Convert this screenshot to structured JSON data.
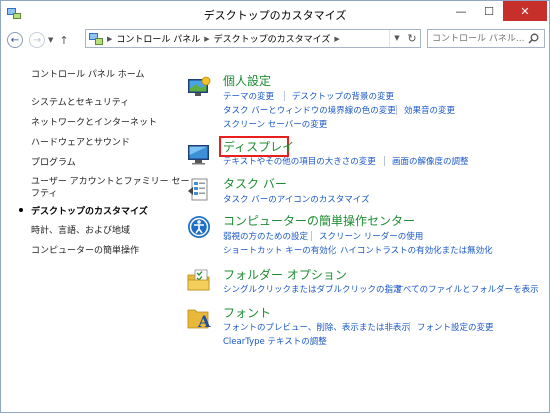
{
  "window": {
    "title": "デスクトップのカスタマイズ",
    "minimize_label": "—",
    "maximize_label": "☐",
    "close_label": "✕"
  },
  "address": {
    "breadcrumb": [
      "コントロール パネル",
      "デスクトップのカスタマイズ"
    ],
    "search_placeholder": "コントロール パネル..."
  },
  "sidebar": {
    "items": [
      {
        "label": "コントロール パネル ホーム"
      },
      {
        "label": "システムとセキュリティ"
      },
      {
        "label": "ネットワークとインターネット"
      },
      {
        "label": "ハードウェアとサウンド"
      },
      {
        "label": "プログラム"
      },
      {
        "label": "ユーザー アカウントとファミリー セー"
      },
      {
        "label": "フティ"
      },
      {
        "label": "デスクトップのカスタマイズ",
        "current": true
      },
      {
        "label": "時計、言語、および地域"
      },
      {
        "label": "コンピューターの簡単操作"
      }
    ]
  },
  "categories": [
    {
      "title": "個人設定",
      "icon": "personalization-icon",
      "links": [
        "テーマの変更",
        "デスクトップの背景の変更",
        "タスク バーとウィンドウの境界線の色の変更",
        "効果音の変更",
        "スクリーン セーバーの変更"
      ]
    },
    {
      "title": "ディスプレイ",
      "icon": "display-icon",
      "links": [
        "テキストやその他の項目の大きさの変更",
        "画面の解像度の調整"
      ]
    },
    {
      "title": "タスク バー",
      "icon": "taskbar-icon",
      "links": [
        "タスク バーのアイコンのカスタマイズ"
      ]
    },
    {
      "title": "コンピューターの簡単操作センター",
      "icon": "ease-of-access-icon",
      "links": [
        "弱視の方のための設定",
        "スクリーン リーダーの使用",
        "ショートカット キーの有効化",
        "ハイコントラストの有効化または無効化"
      ]
    },
    {
      "title": "フォルダー オプション",
      "icon": "folder-options-icon",
      "links": [
        "シングルクリックまたはダブルクリックの指定",
        "すべてのファイルとフォルダーを表示"
      ]
    },
    {
      "title": "フォント",
      "icon": "fonts-icon",
      "links": [
        "フォントのプレビュー、削除、表示または非表示",
        "フォント設定の変更",
        "ClearType テキストの調整"
      ]
    }
  ],
  "colors": {
    "category_title": "#1e8d32",
    "link": "#1a58c7",
    "highlight": "#e8201d",
    "close_button": "#c7302a"
  }
}
